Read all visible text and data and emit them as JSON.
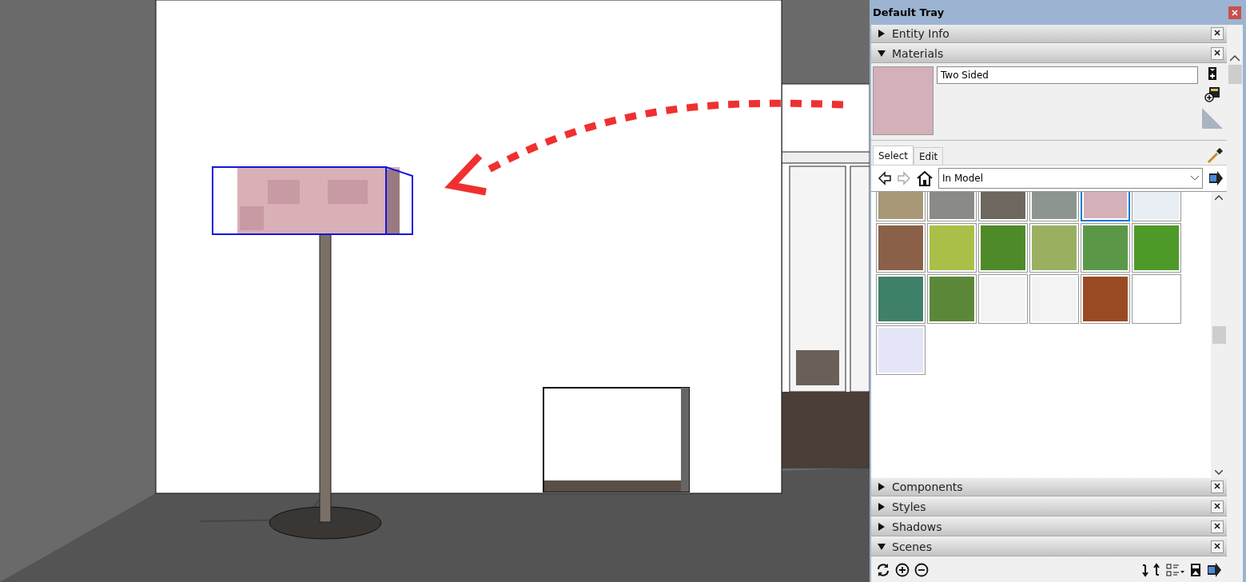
{
  "tray": {
    "title": "Default Tray"
  },
  "panels_top": [
    {
      "label": "Entity Info",
      "expanded": false
    },
    {
      "label": "Materials",
      "expanded": true
    }
  ],
  "materials": {
    "name": "Two Sided",
    "tabs": [
      {
        "label": "Select",
        "selected": true
      },
      {
        "label": "Edit",
        "selected": false
      }
    ],
    "collection": "In Model",
    "swatches": [
      {
        "color": "#a89878",
        "selected": false
      },
      {
        "color": "#8a8a88",
        "selected": false
      },
      {
        "color": "#6e675e",
        "selected": false
      },
      {
        "color": "#8c9590",
        "selected": false
      },
      {
        "color": "#d4b0b8",
        "selected": true
      },
      {
        "color": "#e8eef4",
        "selected": false
      },
      {
        "color": "#8a6048",
        "selected": false
      },
      {
        "color": "#a8c048",
        "selected": false
      },
      {
        "color": "#4f8a28",
        "selected": false
      },
      {
        "color": "#9ab060",
        "selected": false
      },
      {
        "color": "#5a9848",
        "selected": false
      },
      {
        "color": "#4e9a28",
        "selected": false
      },
      {
        "color": "#3f8068",
        "selected": false
      },
      {
        "color": "#5a8838",
        "selected": false
      },
      {
        "color": "#f3f3f3",
        "selected": false
      },
      {
        "color": "#f3f3f3",
        "selected": false
      },
      {
        "color": "#9a4a22",
        "selected": false
      },
      {
        "color": "#ffffff",
        "selected": false
      },
      {
        "color": "#e4e6f8",
        "selected": false
      }
    ]
  },
  "panels_bottom": [
    {
      "label": "Components",
      "expanded": false
    },
    {
      "label": "Styles",
      "expanded": false
    },
    {
      "label": "Shadows",
      "expanded": false
    },
    {
      "label": "Scenes",
      "expanded": true
    }
  ]
}
